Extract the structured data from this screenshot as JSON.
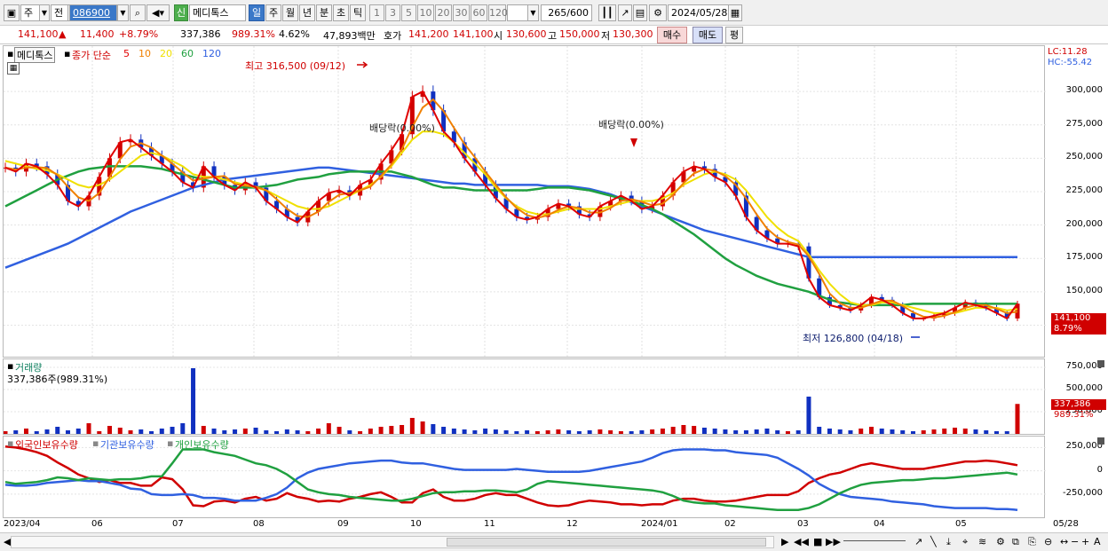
{
  "toolbar": {
    "period_a": "주",
    "period_b": "전",
    "stock_code": "086900",
    "market_badge": "신",
    "stock_name": "메디톡스",
    "intervals": [
      "일",
      "주",
      "월",
      "년",
      "분",
      "초",
      "틱"
    ],
    "numbers": [
      "1",
      "3",
      "5",
      "10",
      "20",
      "30",
      "60",
      "120"
    ],
    "count": "265",
    "count_max": "/600",
    "date": "2024/05/28"
  },
  "quote": {
    "price": "141,100",
    "change_arrow": "▲",
    "change": "11,400",
    "change_pct": "+8.79%",
    "volume": "337,386",
    "volume_pct": "989.31%",
    "turnover_pct": "4.62%",
    "amount": "47,893백만",
    "hoga_label": "호가",
    "hoga_ask": "141,200",
    "hoga_bid": "141,100",
    "open_label": "시",
    "open": "130,600",
    "high_label": "고",
    "high": "150,000",
    "low_label": "저",
    "low": "130,300",
    "buy_label": "매수",
    "sell_label": "매도",
    "avg_label": "평"
  },
  "price_pane": {
    "stock_label": "메디톡스",
    "ma_label": "종가 단순",
    "ma_periods": [
      {
        "label": "5",
        "color": "#e00000"
      },
      {
        "label": "10",
        "color": "#f08000"
      },
      {
        "label": "20",
        "color": "#f0e000"
      },
      {
        "label": "60",
        "color": "#20a040"
      },
      {
        "label": "120",
        "color": "#3060e0"
      }
    ],
    "lc": "LC:11.28",
    "hc": "HC:-55.42",
    "y_ticks": [
      "300,000",
      "275,000",
      "250,000",
      "225,000",
      "200,000",
      "175,000",
      "150,000",
      "125,000"
    ],
    "high_annotation": "최고 316,500 (09/12)",
    "low_annotation": "최저 126,800 (04/18)",
    "dividend_1": "배당락(0.00%)",
    "dividend_2": "배당락(0.00%)",
    "last_price_tag": "141,100",
    "last_pct_tag": "8.79%"
  },
  "volume_pane": {
    "title": "거래량",
    "value": "337,386주(989.31%)",
    "y_ticks": [
      "750,000",
      "500,000",
      "250,000"
    ],
    "last_tag": "337,386",
    "last_pct": "989.31%"
  },
  "holding_pane": {
    "legend": [
      {
        "label": "외국인보유수량",
        "color": "#d00000"
      },
      {
        "label": "기관보유수량",
        "color": "#3060e0"
      },
      {
        "label": "개인보유수량",
        "color": "#20a040"
      }
    ],
    "y_ticks": [
      "250,000",
      "0",
      "-250,000"
    ]
  },
  "x_axis": [
    "2023/04",
    "06",
    "07",
    "08",
    "09",
    "10",
    "11",
    "12",
    "2024/01",
    "02",
    "03",
    "04",
    "05",
    "05/28"
  ],
  "chart_data": {
    "type": "line",
    "title": "",
    "ylim": [
      112000,
      322000
    ],
    "close": [
      243000,
      240000,
      246000,
      244000,
      238000,
      230000,
      218000,
      214000,
      222000,
      236000,
      250000,
      262000,
      264000,
      258000,
      252000,
      246000,
      240000,
      232000,
      228000,
      244000,
      236000,
      230000,
      226000,
      232000,
      228000,
      218000,
      212000,
      206000,
      202000,
      210000,
      218000,
      224000,
      226000,
      222000,
      230000,
      234000,
      246000,
      256000,
      268000,
      296000,
      300000,
      286000,
      270000,
      262000,
      250000,
      240000,
      230000,
      220000,
      212000,
      206000,
      204000,
      206000,
      212000,
      216000,
      214000,
      208000,
      206000,
      214000,
      218000,
      222000,
      218000,
      212000,
      214000,
      222000,
      232000,
      240000,
      244000,
      242000,
      236000,
      232000,
      222000,
      206000,
      196000,
      190000,
      186000,
      186000,
      184000,
      160000,
      146000,
      140000,
      138000,
      136000,
      140000,
      146000,
      144000,
      140000,
      134000,
      130000,
      130000,
      132000,
      134000,
      138000,
      142000,
      140000,
      138000,
      134000,
      130000,
      141100
    ],
    "ma20": [
      248000,
      246000,
      244000,
      242000,
      241000,
      238000,
      234000,
      230000,
      228000,
      230000,
      234000,
      240000,
      246000,
      252000,
      254000,
      252000,
      248000,
      244000,
      238000,
      236000,
      236000,
      234000,
      232000,
      230000,
      228000,
      226000,
      222000,
      218000,
      214000,
      212000,
      212000,
      214000,
      218000,
      222000,
      226000,
      230000,
      236000,
      244000,
      254000,
      264000,
      270000,
      270000,
      268000,
      262000,
      254000,
      246000,
      238000,
      228000,
      220000,
      214000,
      210000,
      208000,
      208000,
      210000,
      212000,
      212000,
      212000,
      212000,
      214000,
      216000,
      218000,
      218000,
      218000,
      220000,
      224000,
      230000,
      234000,
      238000,
      240000,
      238000,
      234000,
      226000,
      216000,
      206000,
      198000,
      192000,
      188000,
      178000,
      166000,
      156000,
      148000,
      142000,
      140000,
      140000,
      142000,
      142000,
      140000,
      138000,
      136000,
      134000,
      134000,
      134000,
      136000,
      138000,
      138000,
      138000,
      136000,
      137000
    ],
    "ma60": [
      214000,
      218000,
      222000,
      226000,
      230000,
      234000,
      237000,
      240000,
      242000,
      243000,
      244000,
      244000,
      244000,
      244000,
      243000,
      242000,
      240000,
      238000,
      236000,
      234000,
      232000,
      230000,
      228000,
      228000,
      228000,
      229000,
      230000,
      232000,
      234000,
      235000,
      236000,
      238000,
      239000,
      240000,
      240000,
      240000,
      240000,
      240000,
      238000,
      236000,
      233000,
      230000,
      228000,
      228000,
      227000,
      226000,
      226000,
      226000,
      226000,
      226000,
      226000,
      227000,
      228000,
      228000,
      228000,
      227000,
      226000,
      224000,
      222000,
      220000,
      218000,
      215000,
      212000,
      208000,
      203000,
      198000,
      193000,
      187000,
      181000,
      175000,
      170000,
      166000,
      162000,
      159000,
      156000,
      154000,
      152000,
      150000,
      147000,
      144000,
      142000,
      141000,
      140000,
      140000,
      140000,
      140000,
      140000,
      141000,
      141000,
      141000,
      141000,
      141000,
      141000,
      141000,
      141000,
      141000,
      141000,
      141000
    ],
    "ma120": [
      168000,
      171000,
      174000,
      177000,
      180000,
      183000,
      186000,
      190000,
      194000,
      198000,
      202000,
      206000,
      210000,
      213000,
      216000,
      219000,
      222000,
      225000,
      228000,
      230000,
      232000,
      234000,
      235000,
      236000,
      237000,
      238000,
      239000,
      240000,
      241000,
      242000,
      243000,
      243000,
      242000,
      241000,
      240000,
      239000,
      238000,
      237000,
      236000,
      235000,
      234000,
      233000,
      232000,
      231000,
      231000,
      230000,
      230000,
      230000,
      230000,
      230000,
      230000,
      230000,
      229000,
      229000,
      229000,
      228000,
      227000,
      225000,
      223000,
      220000,
      217000,
      214000,
      211000,
      208000,
      205000,
      202000,
      199000,
      196000,
      194000,
      192000,
      190000,
      188000,
      186000,
      184000,
      182000,
      180000,
      178000,
      176000,
      176000,
      176000,
      176000,
      176000,
      176000,
      176000,
      176000,
      176000,
      176000,
      176000,
      176000,
      176000,
      176000,
      176000,
      176000,
      176000,
      176000,
      176000,
      176000,
      176000
    ],
    "volume": [
      30000,
      40000,
      60000,
      30000,
      50000,
      80000,
      40000,
      60000,
      120000,
      30000,
      90000,
      70000,
      40000,
      50000,
      30000,
      60000,
      80000,
      120000,
      740000,
      90000,
      60000,
      40000,
      50000,
      60000,
      70000,
      40000,
      30000,
      50000,
      40000,
      30000,
      60000,
      120000,
      80000,
      40000,
      30000,
      60000,
      80000,
      90000,
      100000,
      180000,
      140000,
      110000,
      80000,
      60000,
      50000,
      40000,
      60000,
      50000,
      40000,
      30000,
      40000,
      30000,
      40000,
      50000,
      40000,
      30000,
      40000,
      50000,
      40000,
      30000,
      30000,
      40000,
      50000,
      60000,
      80000,
      100000,
      90000,
      70000,
      60000,
      50000,
      40000,
      40000,
      50000,
      60000,
      40000,
      30000,
      40000,
      420000,
      80000,
      60000,
      50000,
      40000,
      60000,
      80000,
      60000,
      50000,
      40000,
      30000,
      40000,
      50000,
      60000,
      70000,
      60000,
      50000,
      40000,
      30000,
      30000,
      337386
    ],
    "foreign": [
      260000,
      250000,
      230000,
      200000,
      160000,
      90000,
      30000,
      -40000,
      -80000,
      -120000,
      -100000,
      -130000,
      -130000,
      -160000,
      -160000,
      -70000,
      -90000,
      -200000,
      -370000,
      -380000,
      -330000,
      -320000,
      -340000,
      -300000,
      -280000,
      -320000,
      -300000,
      -240000,
      -280000,
      -300000,
      -330000,
      -320000,
      -330000,
      -300000,
      -280000,
      -250000,
      -230000,
      -280000,
      -340000,
      -340000,
      -240000,
      -200000,
      -280000,
      -320000,
      -320000,
      -300000,
      -260000,
      -240000,
      -260000,
      -260000,
      -300000,
      -340000,
      -370000,
      -380000,
      -370000,
      -340000,
      -320000,
      -330000,
      -340000,
      -360000,
      -360000,
      -370000,
      -360000,
      -360000,
      -320000,
      -300000,
      -300000,
      -320000,
      -330000,
      -330000,
      -320000,
      -300000,
      -280000,
      -260000,
      -260000,
      -260000,
      -220000,
      -130000,
      -80000,
      -40000,
      -20000,
      20000,
      60000,
      80000,
      60000,
      40000,
      20000,
      20000,
      20000,
      40000,
      60000,
      80000,
      100000,
      100000,
      110000,
      100000,
      80000,
      60000
    ],
    "institution": [
      -150000,
      -160000,
      -160000,
      -150000,
      -130000,
      -120000,
      -110000,
      -100000,
      -110000,
      -110000,
      -130000,
      -150000,
      -190000,
      -200000,
      -250000,
      -260000,
      -260000,
      -250000,
      -260000,
      -290000,
      -290000,
      -300000,
      -320000,
      -320000,
      -320000,
      -290000,
      -250000,
      -180000,
      -80000,
      -20000,
      20000,
      40000,
      60000,
      80000,
      90000,
      100000,
      110000,
      110000,
      90000,
      80000,
      80000,
      60000,
      40000,
      20000,
      10000,
      10000,
      10000,
      10000,
      10000,
      20000,
      10000,
      0,
      -10000,
      -10000,
      -10000,
      -10000,
      0,
      20000,
      40000,
      60000,
      80000,
      100000,
      140000,
      190000,
      220000,
      230000,
      230000,
      230000,
      220000,
      220000,
      200000,
      190000,
      180000,
      170000,
      140000,
      80000,
      20000,
      -50000,
      -140000,
      -200000,
      -250000,
      -280000,
      -290000,
      -300000,
      -310000,
      -330000,
      -340000,
      -350000,
      -360000,
      -380000,
      -390000,
      -400000,
      -400000,
      -400000,
      -400000,
      -410000,
      -410000,
      -420000
    ],
    "individual": [
      -120000,
      -140000,
      -130000,
      -120000,
      -100000,
      -70000,
      -80000,
      -100000,
      -80000,
      -90000,
      -100000,
      -90000,
      -90000,
      -80000,
      -60000,
      -60000,
      80000,
      230000,
      230000,
      230000,
      200000,
      180000,
      160000,
      120000,
      80000,
      60000,
      20000,
      -40000,
      -120000,
      -200000,
      -230000,
      -250000,
      -260000,
      -280000,
      -290000,
      -300000,
      -310000,
      -320000,
      -320000,
      -300000,
      -270000,
      -240000,
      -230000,
      -230000,
      -220000,
      -220000,
      -210000,
      -210000,
      -220000,
      -230000,
      -200000,
      -140000,
      -110000,
      -120000,
      -130000,
      -140000,
      -150000,
      -160000,
      -170000,
      -180000,
      -190000,
      -200000,
      -210000,
      -230000,
      -270000,
      -320000,
      -340000,
      -350000,
      -350000,
      -370000,
      -380000,
      -390000,
      -400000,
      -410000,
      -420000,
      -420000,
      -420000,
      -400000,
      -360000,
      -300000,
      -240000,
      -190000,
      -150000,
      -130000,
      -120000,
      -110000,
      -100000,
      -100000,
      -90000,
      -80000,
      -80000,
      -70000,
      -60000,
      -50000,
      -40000,
      -30000,
      -20000,
      -40000
    ]
  }
}
